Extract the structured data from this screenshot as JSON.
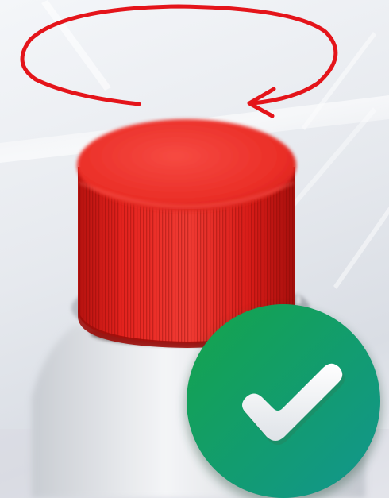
{
  "scene": {
    "subject": "red-bottle-cap",
    "rotation_direction": "counterclockwise-arrow",
    "status": "check-badge"
  },
  "colors": {
    "cap_red": "#e8241f",
    "cap_dark_red": "#b0120f",
    "arrow_red": "#e4141a",
    "badge_green": "#14a44a",
    "badge_teal": "#11958f",
    "check_white": "#ffffff",
    "background": "#e6e9ee"
  },
  "icons": [
    "rotation-arrow-icon",
    "check-badge-icon",
    "checkmark-icon"
  ]
}
